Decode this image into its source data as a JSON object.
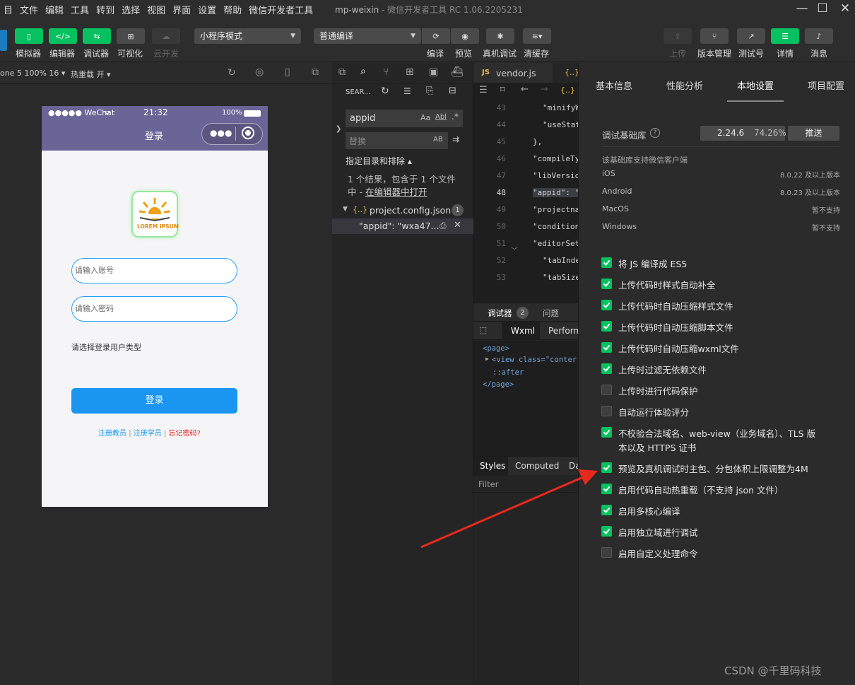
{
  "menu": [
    "目",
    "文件",
    "编辑",
    "工具",
    "转到",
    "选择",
    "视图",
    "界面",
    "设置",
    "帮助",
    "微信开发者工具"
  ],
  "window_title": "mp-weixin",
  "window_subtitle": " - 微信开发者工具 RC 1.06.2205231",
  "toolbar": {
    "left_buttons": [
      "模拟器",
      "编辑器",
      "调试器",
      "可视化",
      "云开发"
    ],
    "mode_select": "小程序模式",
    "compile_select": "普通编译",
    "mid_buttons": [
      "编译",
      "预览",
      "真机调试",
      "清缓存"
    ],
    "right_buttons": [
      "上传",
      "版本管理",
      "测试号",
      "详情",
      "消息"
    ]
  },
  "simulator": {
    "device": "one 5 100% 16",
    "hot_reload": "热重载 开",
    "status_left": "●●●●● WeChat",
    "status_time": "21:32",
    "status_battery": "100%",
    "nav_title": "登录",
    "logo_text": "LOREM IPSUM",
    "account_placeholder": "请输入账号",
    "password_placeholder": "请输入密码",
    "user_type_label": "请选择登录用户类型",
    "login_button": "登录",
    "link_teacher": "注册教员",
    "link_sep1": "|",
    "link_student": "注册学员",
    "link_sep2": "|",
    "link_forgot": "忘记密码?"
  },
  "search": {
    "header": "SEAR...",
    "query": "appid",
    "match_case": "Aa",
    "whole_word": "Abl",
    "regex": ".*",
    "replace_placeholder": "替换",
    "replace_ab": "AB",
    "scope": "指定目录和排除",
    "result_line1": "1 个结果，包含于 1 个文件",
    "result_line2_prefix": "中 - ",
    "result_line2_link": "在编辑器中打开",
    "file": "project.config.json",
    "file_count": "1",
    "match": "\"appid\": \"wxa47..."
  },
  "editor": {
    "tab": "vendor.js",
    "lines": [
      {
        "n": "43",
        "t": "\"minifyW"
      },
      {
        "n": "44",
        "t": "\"useStat"
      },
      {
        "n": "45",
        "t": "},"
      },
      {
        "n": "46",
        "t": "\"compileTy"
      },
      {
        "n": "47",
        "t": "\"libVersio"
      },
      {
        "n": "48",
        "t": "\"appid\": \""
      },
      {
        "n": "49",
        "t": "\"projectna"
      },
      {
        "n": "50",
        "t": "\"condition"
      },
      {
        "n": "51",
        "t": "\"editorSet"
      },
      {
        "n": "52",
        "t": "\"tabInde"
      },
      {
        "n": "53",
        "t": "\"tabSize"
      }
    ]
  },
  "debugger": {
    "tab": "调试器",
    "badge": "2",
    "tab2": "问题",
    "wxml": "Wxml",
    "perf": "Perform",
    "dom": [
      "<page>",
      "<view class=\"conter",
      "::after",
      "</page>"
    ],
    "styles": "Styles",
    "computed": "Computed",
    "da": "Da",
    "filter": "Filter"
  },
  "settings": {
    "tabs": [
      "基本信息",
      "性能分析",
      "本地设置",
      "项目配置"
    ],
    "lib_label": "调试基础库",
    "lib_version": "2.24.6",
    "lib_percent": "74.26%",
    "push": "推送",
    "support_title": "该基础库支持微信客户端",
    "platforms": [
      {
        "name": "iOS",
        "value": "8.0.22 及以上版本"
      },
      {
        "name": "Android",
        "value": "8.0.23 及以上版本"
      },
      {
        "name": "MacOS",
        "value": "暂不支持"
      },
      {
        "name": "Windows",
        "value": "暂不支持"
      }
    ],
    "options": [
      {
        "label": "将 JS 编译成 ES5",
        "checked": true
      },
      {
        "label": "上传代码时样式自动补全",
        "checked": true
      },
      {
        "label": "上传代码时自动压缩样式文件",
        "checked": true
      },
      {
        "label": "上传代码时自动压缩脚本文件",
        "checked": true
      },
      {
        "label": "上传代码时自动压缩wxml文件",
        "checked": true
      },
      {
        "label": "上传时过滤无依赖文件",
        "checked": true
      },
      {
        "label": "上传时进行代码保护",
        "checked": false
      },
      {
        "label": "自动运行体验评分",
        "checked": false
      },
      {
        "label": "不校验合法域名、web-view（业务域名）、TLS 版",
        "label2": "本以及 HTTPS 证书",
        "checked": true
      },
      {
        "label": "预览及真机调试时主包、分包体积上限调整为4M",
        "checked": true
      },
      {
        "label": "启用代码自动热重载（不支持 json 文件）",
        "checked": true
      },
      {
        "label": "启用多核心编译",
        "checked": true
      },
      {
        "label": "启用独立域进行调试",
        "checked": true
      },
      {
        "label": "启用自定义处理命令",
        "checked": false
      }
    ]
  },
  "watermark": "CSDN @千里码科技",
  "colors": {
    "accent": "#07c160",
    "arrow": "#e8291c",
    "link": "#1a95f0"
  }
}
